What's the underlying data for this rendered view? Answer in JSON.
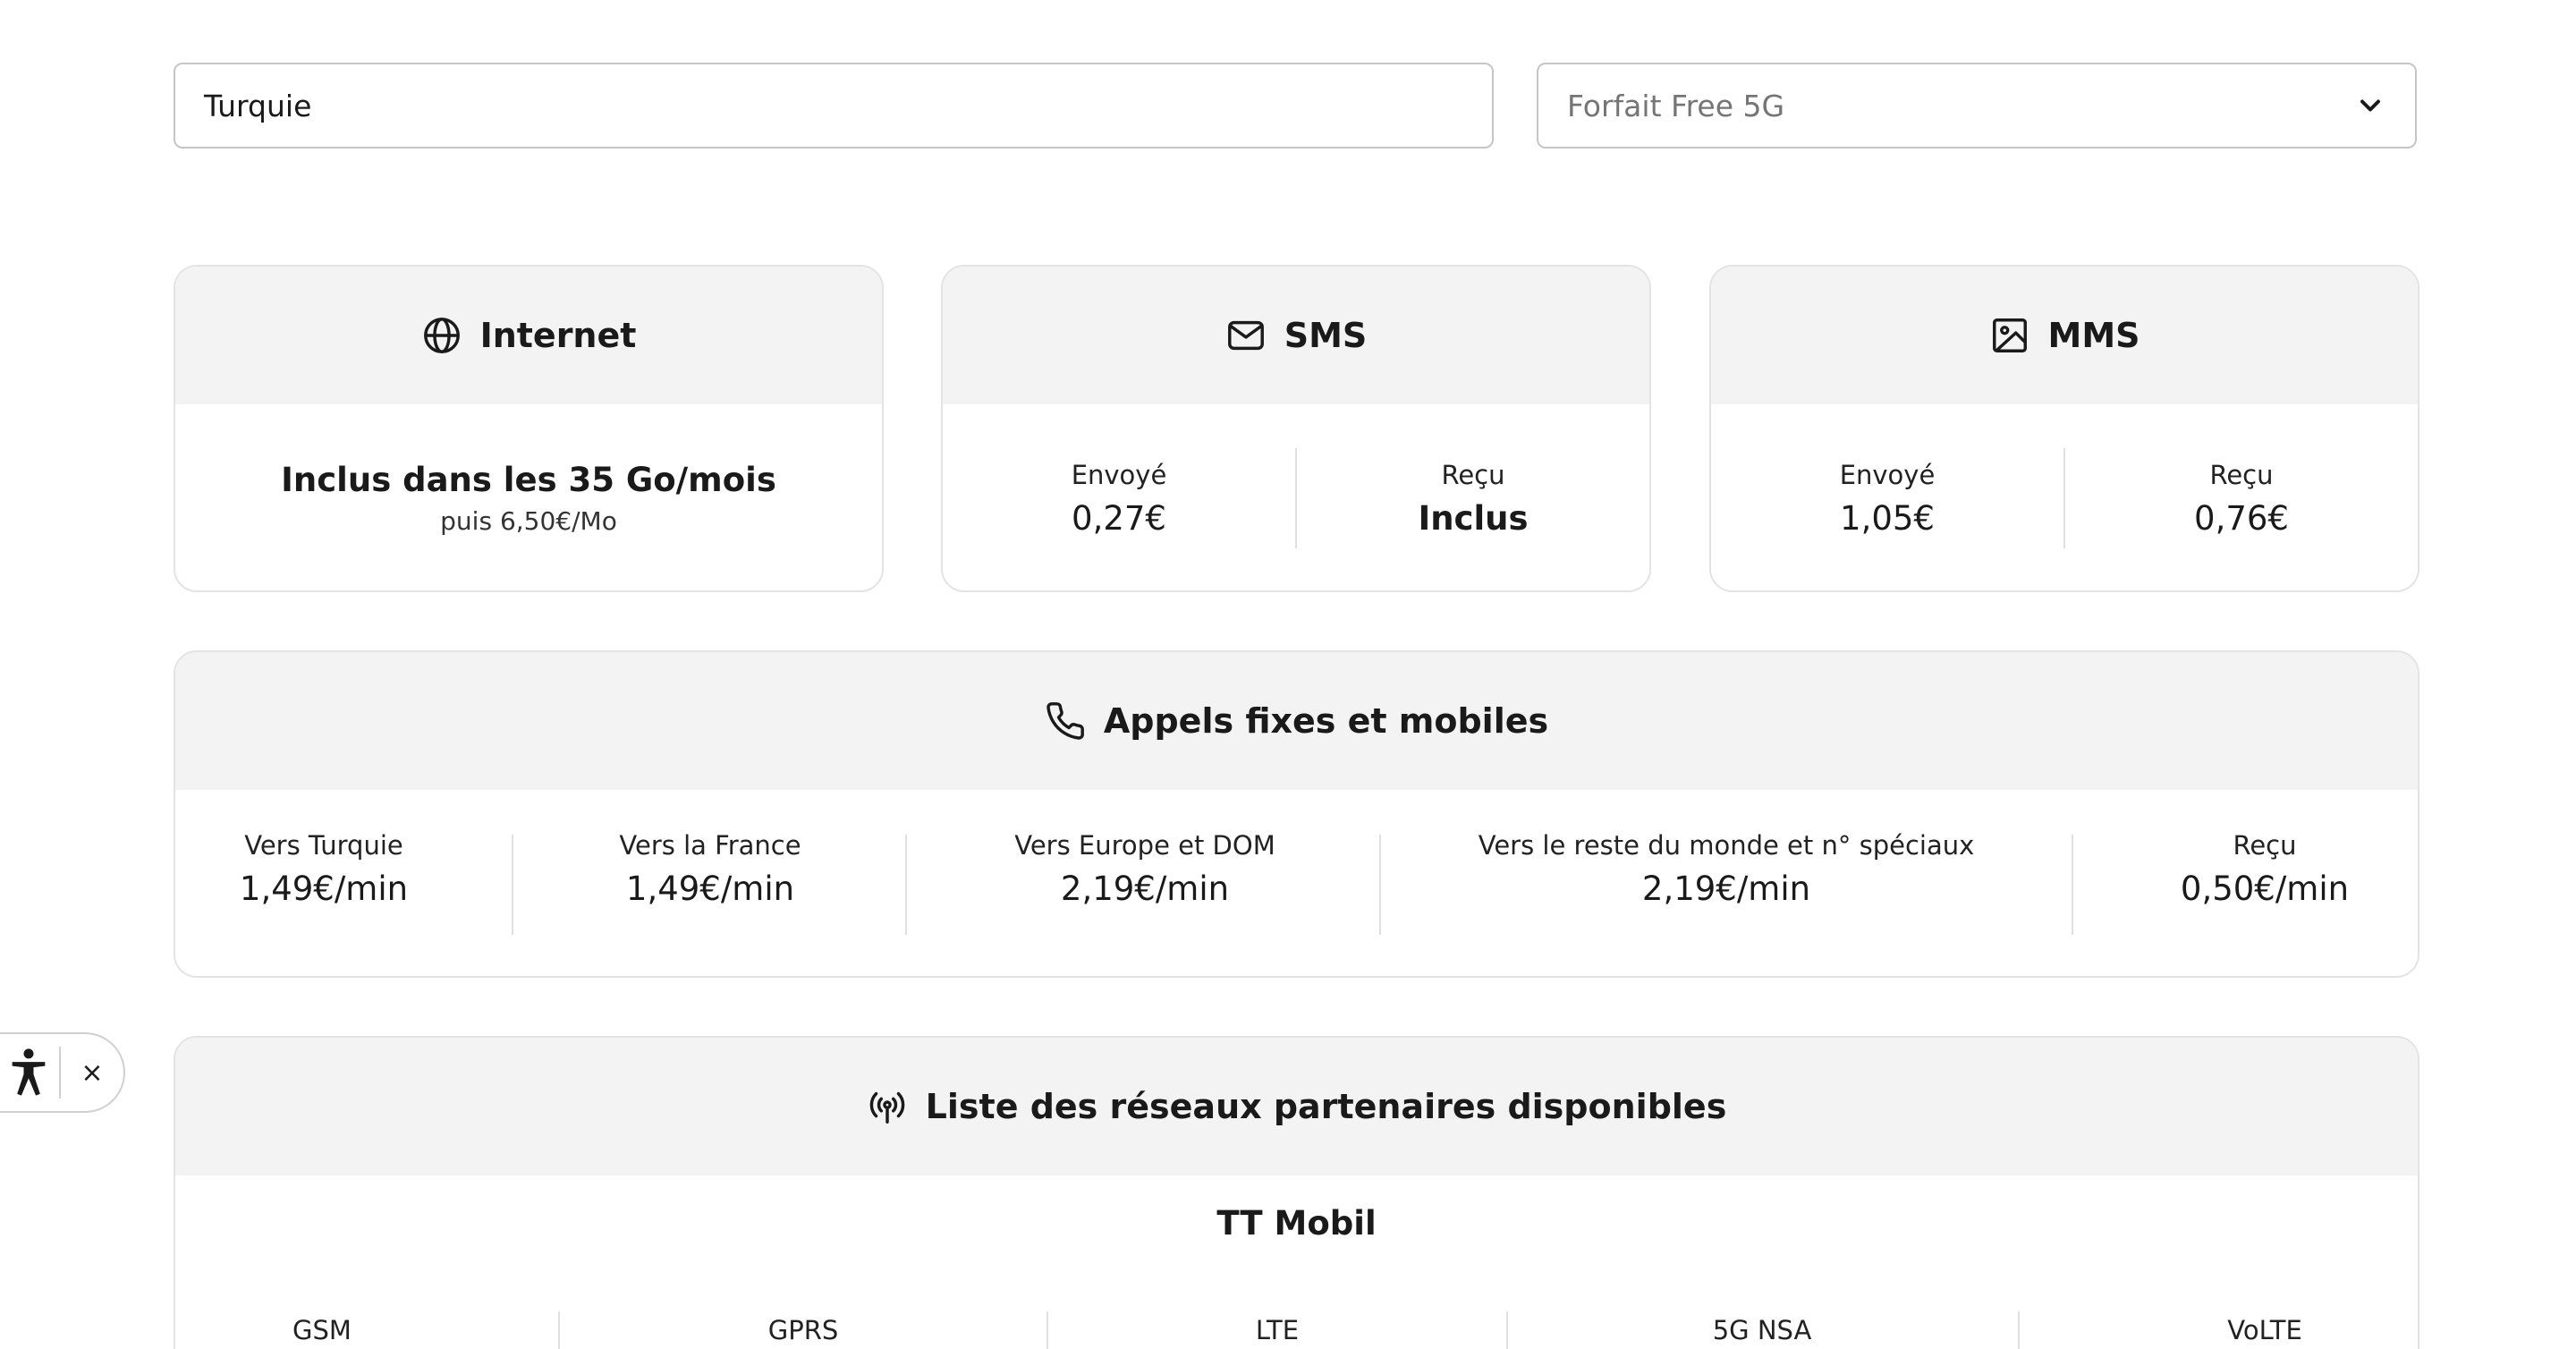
{
  "search": {
    "country_value": "Turquie",
    "plan_value": "Forfait Free 5G"
  },
  "internet": {
    "title": "Internet",
    "main": "Inclus dans les 35 Go/mois",
    "sub": "puis 6,50€/Mo"
  },
  "sms": {
    "title": "SMS",
    "sent_label": "Envoyé",
    "sent_value": "0,27€",
    "received_label": "Reçu",
    "received_value": "Inclus"
  },
  "mms": {
    "title": "MMS",
    "sent_label": "Envoyé",
    "sent_value": "1,05€",
    "received_label": "Reçu",
    "received_value": "0,76€"
  },
  "calls": {
    "title": "Appels fixes et mobiles",
    "columns": [
      {
        "label": "Vers Turquie",
        "value": "1,49€/min"
      },
      {
        "label": "Vers la France",
        "value": "1,49€/min"
      },
      {
        "label": "Vers Europe et DOM",
        "value": "2,19€/min"
      },
      {
        "label": "Vers le reste du monde et n° spéciaux",
        "value": "2,19€/min"
      },
      {
        "label": "Reçu",
        "value": "0,50€/min"
      }
    ]
  },
  "networks": {
    "title": "Liste des réseaux partenaires disponibles",
    "operator": "TT Mobil",
    "technologies": [
      "GSM",
      "GPRS",
      "LTE",
      "5G NSA",
      "VoLTE"
    ]
  },
  "accessibility": {
    "close_label": "×"
  }
}
